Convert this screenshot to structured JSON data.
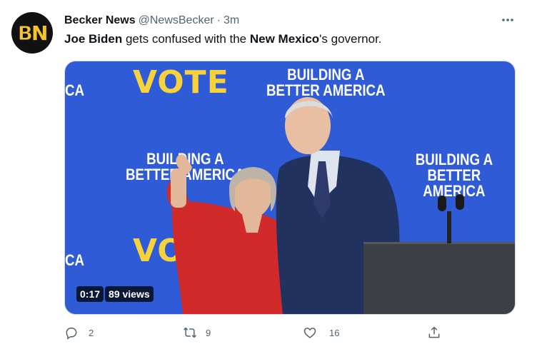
{
  "author": {
    "name": "Becker News",
    "handle": "@NewsBecker",
    "separator": "·",
    "time": "3m",
    "avatar_text_b": "B",
    "avatar_text_n": "N"
  },
  "tweet": {
    "text_parts": [
      "Joe Biden",
      " gets confused with the ",
      "New Mexico",
      "'s governor."
    ]
  },
  "media": {
    "duration": "0:17",
    "views": "89 views",
    "signs": {
      "vote": "VOTE",
      "building_line1": "BUILDING A",
      "building_line2": "BETTER AMERICA",
      "fragment_ca": "CA"
    }
  },
  "actions": {
    "reply_count": "2",
    "retweet_count": "9",
    "like_count": "16"
  },
  "icons": {
    "more": "more-icon",
    "reply": "reply-icon",
    "retweet": "retweet-icon",
    "like": "heart-icon",
    "share": "share-icon"
  },
  "colors": {
    "text": "#0f1419",
    "muted": "#536471",
    "backdrop_blue": "#2f5bd6",
    "vote_yellow": "#f7d23a"
  }
}
